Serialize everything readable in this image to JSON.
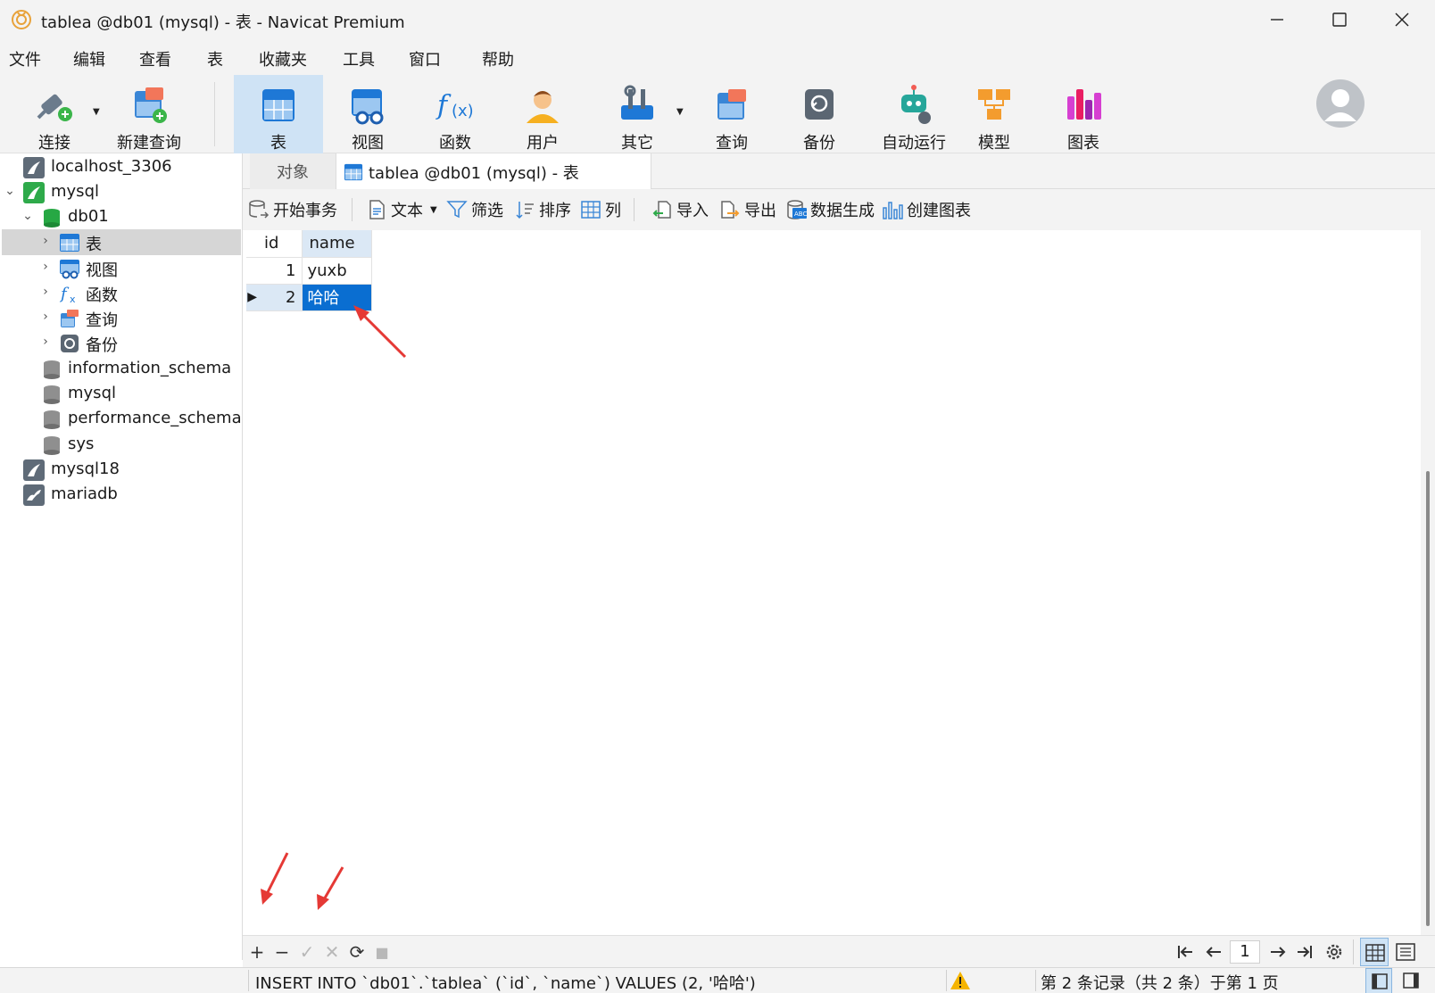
{
  "window": {
    "title": "tablea @db01 (mysql) - 表 - Navicat Premium",
    "minimize": "–",
    "maximize": "☐",
    "close": "✕"
  },
  "menu": [
    "文件",
    "编辑",
    "查看",
    "表",
    "收藏夹",
    "工具",
    "窗口",
    "帮助"
  ],
  "toolbar": {
    "connect": "连接",
    "new_query": "新建查询",
    "table": "表",
    "view": "视图",
    "function": "函数",
    "user": "用户",
    "other": "其它",
    "query": "查询",
    "backup": "备份",
    "automation": "自动运行",
    "model": "模型",
    "chart": "图表"
  },
  "sidebar": {
    "items": [
      {
        "label": "localhost_3306",
        "icon": "connection-icon"
      },
      {
        "label": "mysql",
        "icon": "mysql-connection-icon",
        "expanded": true
      },
      {
        "label": "db01",
        "icon": "database-icon",
        "expanded": true
      },
      {
        "label": "表",
        "icon": "table-icon",
        "selected": true
      },
      {
        "label": "视图",
        "icon": "view-icon"
      },
      {
        "label": "函数",
        "icon": "function-icon"
      },
      {
        "label": "查询",
        "icon": "query-icon"
      },
      {
        "label": "备份",
        "icon": "backup-icon"
      },
      {
        "label": "information_schema",
        "icon": "database-icon"
      },
      {
        "label": "mysql",
        "icon": "database-icon"
      },
      {
        "label": "performance_schema",
        "icon": "database-icon"
      },
      {
        "label": "sys",
        "icon": "database-icon"
      },
      {
        "label": "mysql18",
        "icon": "connection-icon"
      },
      {
        "label": "mariadb",
        "icon": "mariadb-connection-icon"
      }
    ]
  },
  "tabs": {
    "objects": "对象",
    "active": "tablea @db01 (mysql) - 表"
  },
  "subtoolbar": {
    "begin_transaction": "开始事务",
    "text": "文本",
    "filter": "筛选",
    "sort": "排序",
    "columns": "列",
    "import": "导入",
    "export": "导出",
    "data_generation": "数据生成",
    "create_chart": "创建图表"
  },
  "grid": {
    "columns": [
      "id",
      "name"
    ],
    "rows": [
      {
        "id": "1",
        "name": "yuxb"
      },
      {
        "id": "2",
        "name": "哈哈"
      }
    ],
    "current_row": 1
  },
  "navbar": {
    "add": "+",
    "delete": "−",
    "apply": "✓",
    "discard": "✕",
    "refresh": "⟳",
    "stop": "■",
    "page": "1"
  },
  "status": {
    "sql": "INSERT INTO `db01`.`tablea` (`id`, `name`) VALUES (2, '哈哈')",
    "record_info": "第 2 条记录（共 2 条）于第 1 页"
  },
  "colors": {
    "accent": "#0a6ed1",
    "selected_tab": "#cfe3f5",
    "annotation": "#e53935"
  }
}
